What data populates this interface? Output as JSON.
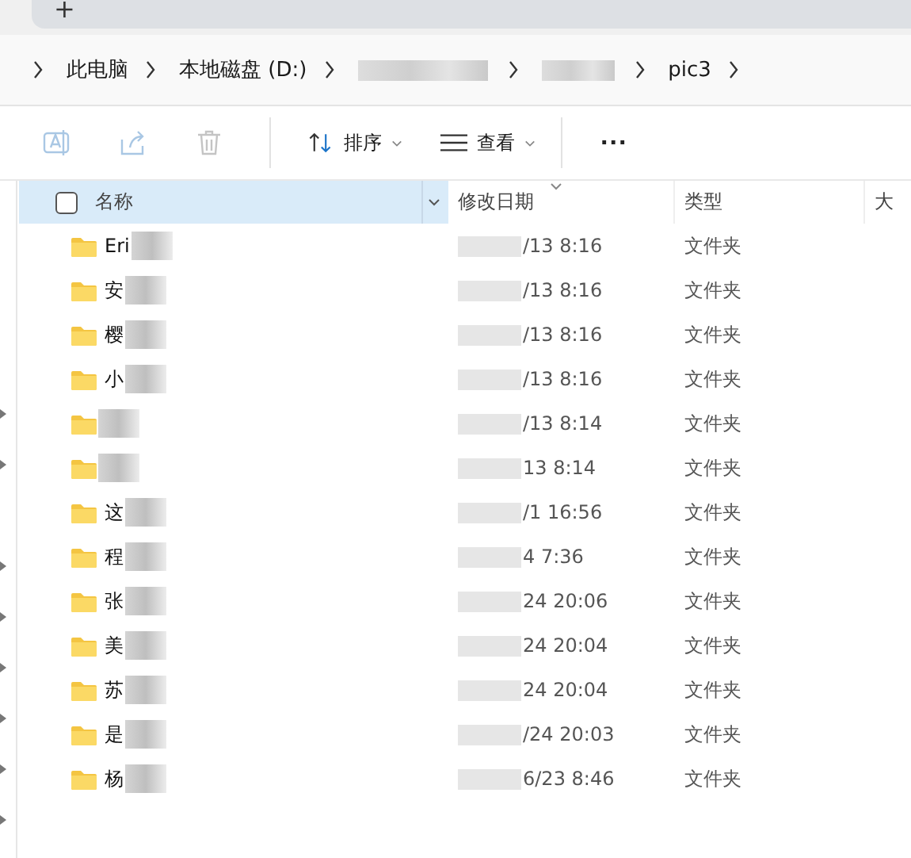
{
  "tab_strip": {
    "new_tab": "+"
  },
  "breadcrumbs": [
    {
      "label": "此电脑"
    },
    {
      "label": "本地磁盘 (D:)"
    },
    {
      "kind": "hidden"
    },
    {
      "kind": "hidden"
    },
    {
      "label": "pic3"
    }
  ],
  "toolbar": {
    "sort": "排序",
    "view": "查看",
    "more": "..."
  },
  "table": {
    "select_all": {
      "checked": false
    },
    "columns": [
      "名称",
      "修改日期",
      "类型",
      "大"
    ],
    "rows": [
      {
        "name": "Eri",
        "modified": "/13 8:16",
        "type": "文件夹"
      },
      {
        "name": "安",
        "modified": "/13 8:16",
        "type": "文件夹"
      },
      {
        "name": "樱",
        "modified": "/13 8:16",
        "type": "文件夹"
      },
      {
        "name": "小",
        "modified": "/13 8:16",
        "type": "文件夹"
      },
      {
        "modified": "/13 8:14",
        "type": "文件夹"
      },
      {
        "modified": "13 8:14",
        "type": "文件夹"
      },
      {
        "name": "这",
        "modified": "/1 16:56",
        "type": "文件夹"
      },
      {
        "name": "程",
        "modified": "4 7:36",
        "type": "文件夹"
      },
      {
        "name": "张",
        "modified": "24 20:06",
        "type": "文件夹"
      },
      {
        "name": "美",
        "modified": "24 20:04",
        "type": "文件夹"
      },
      {
        "name": "苏",
        "modified": "24 20:04",
        "type": "文件夹"
      },
      {
        "name": "是",
        "modified": "/24 20:03",
        "type": "文件夹"
      },
      {
        "name": "杨",
        "modified": "6/23 8:46",
        "type": "文件夹"
      }
    ]
  }
}
